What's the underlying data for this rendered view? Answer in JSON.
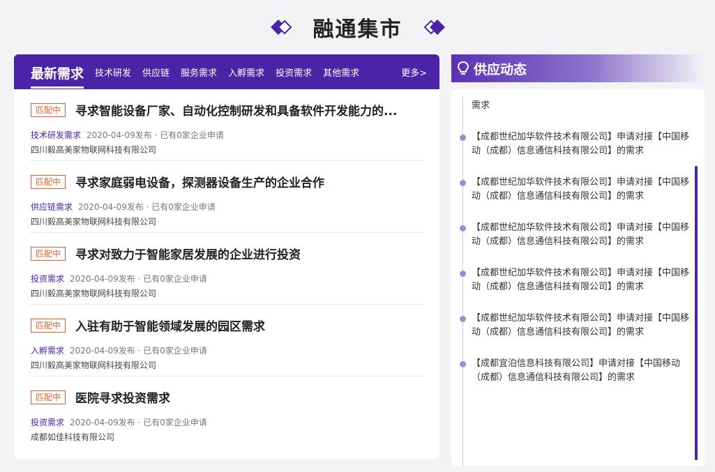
{
  "header": {
    "title": "融通集市"
  },
  "tabs": {
    "main": "最新需求",
    "items": [
      "技术研发",
      "供应链",
      "服务需求",
      "入孵需求",
      "投资需求",
      "其他需求"
    ],
    "more": "更多>"
  },
  "demands": [
    {
      "badge": "匹配中",
      "title": "寻求智能设备厂家、自动化控制研发和具备软件开发能力的...",
      "category": "技术研发需求",
      "meta": "2020-04-09发布 · 已有0家企业申请",
      "company": "四川毅高美家物联网科技有限公司"
    },
    {
      "badge": "匹配中",
      "title": "寻求家庭弱电设备，探测器设备生产的企业合作",
      "category": "供应链需求",
      "meta": "2020-04-09发布 · 已有0家企业申请",
      "company": "四川毅高美家物联网科技有限公司"
    },
    {
      "badge": "匹配中",
      "title": "寻求对致力于智能家居发展的企业进行投资",
      "category": "投资需求",
      "meta": "2020-04-09发布 · 已有0家企业申请",
      "company": "四川毅高美家物联网科技有限公司"
    },
    {
      "badge": "匹配中",
      "title": "入驻有助于智能领域发展的园区需求",
      "category": "入孵需求",
      "meta": "2020-04-09发布 · 已有0家企业申请",
      "company": "四川毅高美家物联网科技有限公司"
    },
    {
      "badge": "匹配中",
      "title": "医院寻求投资需求",
      "category": "投资需求",
      "meta": "2020-04-09发布 · 已有0家企业申请",
      "company": "成都如佳科技有限公司"
    }
  ],
  "supply": {
    "title": "供应动态",
    "partial_top": "需求",
    "items": [
      "【成都世纪加华软件技术有限公司】申请对接【中国移动（成都）信息通信科技有限公司】的需求",
      "【成都世纪加华软件技术有限公司】申请对接【中国移动（成都）信息通信科技有限公司】的需求",
      "【成都世纪加华软件技术有限公司】申请对接【中国移动（成都）信息通信科技有限公司】的需求",
      "【成都世纪加华软件技术有限公司】申请对接【中国移动（成都）信息通信科技有限公司】的需求",
      "【成都世纪加华软件技术有限公司】申请对接【中国移动（成都）信息通信科技有限公司】的需求",
      "【成都宜泊信息科技有限公司】申请对接【中国移动（成都）信息通信科技有限公司】的需求"
    ]
  },
  "colors": {
    "accent": "#4a23a7",
    "badge": "#e45d2b"
  }
}
